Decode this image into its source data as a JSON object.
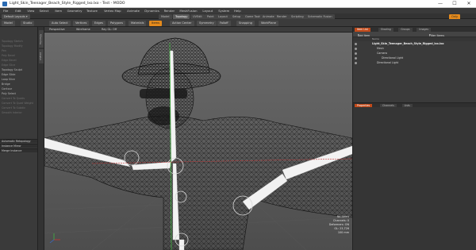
{
  "window": {
    "title": "Light_Skin_Teenager_Beach_Style_Rigged_lxo.lxo - Test - MODO",
    "minimize_glyph": "—",
    "maximize_glyph": "☐",
    "close_glyph": "✕"
  },
  "menu": [
    "File",
    "Edit",
    "View",
    "Select",
    "Item",
    "Geometry",
    "Texture",
    "Vertex Map",
    "Animate",
    "Dynamics",
    "Render",
    "MeshFusion",
    "Layout",
    "System",
    "Help"
  ],
  "layout_tabs": [
    "Model",
    "Topology",
    "UVEdit",
    "Paint",
    "Layout",
    "Setup",
    "Game Tools",
    "Animate",
    "Render",
    "Scripting",
    "Schematic Fusion"
  ],
  "active_layout_tab": "Topology",
  "layouts_dropdown": "Default Layouts",
  "only_label": "Only",
  "toolbar": {
    "model": "Model",
    "studio": "Studio",
    "auto_select": "Auto Select",
    "vertices": "Vertices",
    "edges": "Edges",
    "polygons": "Polygons",
    "materials": "Materials",
    "items": "Items",
    "action_center": "Action Center",
    "symmetry": "Symmetry",
    "falloff": "Falloff",
    "snapping": "Snapping",
    "workplane": "WorkPlane"
  },
  "left_panel": {
    "items": [
      {
        "label": "Topology Sketch",
        "dim": true
      },
      {
        "label": "Topology Modify",
        "dim": true
      },
      {
        "label": "Pen",
        "dim": true
      },
      {
        "label": "Poly Bevel",
        "dim": true
      },
      {
        "label": "Edge Bevel",
        "dim": true
      },
      {
        "label": "Edge Slice",
        "dim": true
      },
      {
        "label": "Topology Sculpt",
        "dim": false
      },
      {
        "label": "Edge Slide",
        "dim": false
      },
      {
        "label": "Loop Slice",
        "dim": false
      },
      {
        "label": "Bridge",
        "dim": false
      },
      {
        "label": "Contour",
        "dim": false
      },
      {
        "label": "Poly Select",
        "dim": false
      },
      {
        "label": "Convert To Quads",
        "dim": true
      },
      {
        "label": "Convert To Quad Weights",
        "dim": true
      },
      {
        "label": "Convert To Subdiv",
        "dim": true
      },
      {
        "label": "Smooth Interior",
        "dim": true
      }
    ],
    "section_heads": [
      "Automatic Retopology",
      "Instance Mirror",
      "Merge Instance"
    ]
  },
  "side_strip": {
    "tab1": "Topology",
    "tab2": "UVEdit"
  },
  "viewport": {
    "view_type": "Perspective",
    "shading": "Wireframe",
    "ray_gl": "Ray GL: Off",
    "info": {
      "selection": "No Items",
      "channels": "Channels: 0",
      "deformers": "Deformers: ON",
      "gl": "GL: 23,726",
      "scale": "100 mm"
    }
  },
  "right_panel": {
    "top_tabs": [
      "Item List",
      "Shading",
      "Groups",
      "Images"
    ],
    "active_tab": "Item List",
    "add_item": "Add Item",
    "filter_items": "Filter Items",
    "col_name": "Name",
    "tree": [
      {
        "label": "Light_Skin_Teenager_Beach_Style_Rigged_lxo.lxo",
        "indent": 0,
        "bold": true
      },
      {
        "label": "Mesh",
        "indent": 1,
        "bold": false
      },
      {
        "label": "Camera",
        "indent": 1,
        "bold": false
      },
      {
        "label": "Directional Light",
        "indent": 2,
        "bold": false
      },
      {
        "label": "Directional Light",
        "indent": 1,
        "bold": false
      }
    ],
    "lower_tabs": [
      "Properties",
      "Channels",
      "Lists"
    ],
    "active_lower_tab": "Properties"
  },
  "colors": {
    "accent_orange": "#e48a1c",
    "tab_red": "#c24a1a",
    "axis_green": "#3fb43f",
    "axis_red": "#c83232"
  }
}
